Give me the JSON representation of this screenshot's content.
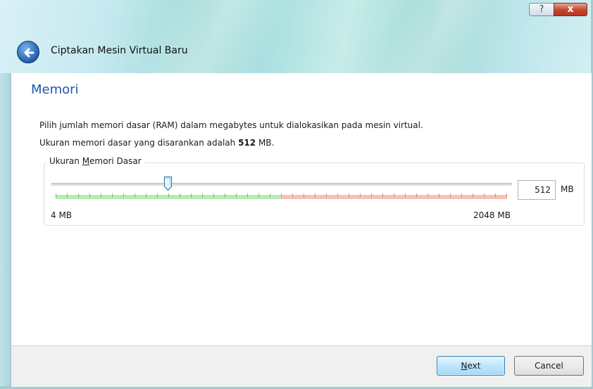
{
  "window": {
    "title": "Ciptakan Mesin Virtual Baru",
    "help_glyph": "?",
    "close_glyph": "x"
  },
  "page": {
    "title": "Memori",
    "description_line1": "Pilih jumlah memori dasar (RAM) dalam megabytes untuk dialokasikan pada mesin virtual.",
    "description_line2_prefix": "Ukuran memori dasar yang disarankan adalah ",
    "description_line2_value": "512",
    "description_line2_suffix": " MB."
  },
  "memory": {
    "group_label_before": "Ukuran ",
    "group_label_mnemonic": "M",
    "group_label_after": "emori Dasar",
    "min_label": "4 MB",
    "max_label": "2048 MB",
    "min_value": 4,
    "max_value": 2048,
    "value": 512,
    "value_text": "512",
    "unit": "MB"
  },
  "buttons": {
    "next_mnemonic": "N",
    "next_rest": "ext",
    "cancel": "Cancel"
  },
  "colors": {
    "accent": "#1f57a8",
    "safe_zone": "#b7ecb3",
    "warn_zone": "#f6c2b5"
  },
  "icons": {
    "back": "back-arrow-icon",
    "help": "help-icon",
    "close": "close-icon"
  }
}
